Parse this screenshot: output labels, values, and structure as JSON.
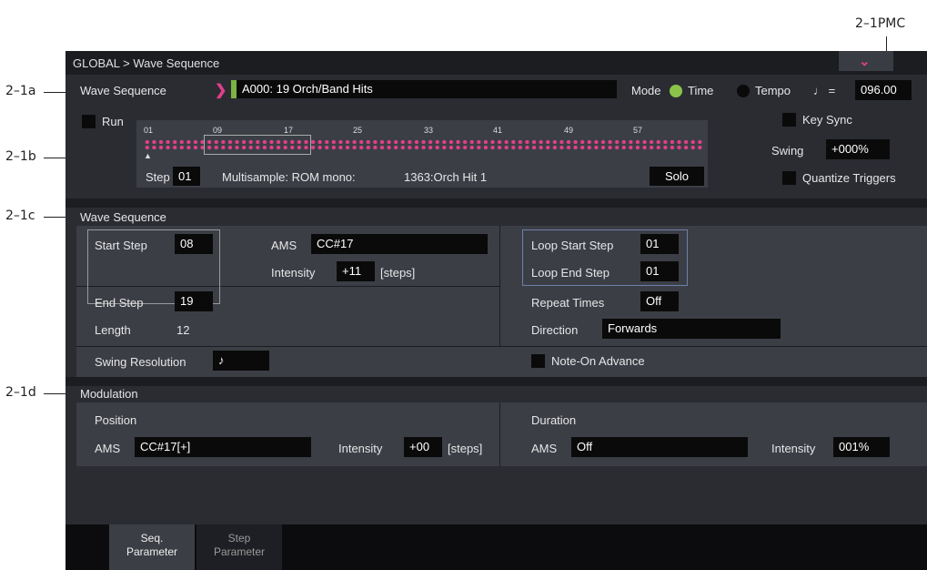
{
  "callouts": {
    "pmc": "2–1PMC",
    "a": "2–1a",
    "b": "2–1b",
    "c": "2–1c",
    "d": "2–1d"
  },
  "titlebar": {
    "path": "GLOBAL > Wave Sequence",
    "menu_icon": "chevron-down-icon"
  },
  "top": {
    "ws_label": "Wave Sequence",
    "ws_value": "A000: 19 Orch/Band Hits",
    "mode_label": "Mode",
    "mode_time": "Time",
    "mode_tempo": "Tempo",
    "tempo_symbol": "♩ =",
    "tempo_value": "096.00",
    "run_label": "Run",
    "key_sync_label": "Key Sync",
    "swing_label": "Swing",
    "swing_value": "+000%",
    "quantize_label": "Quantize Triggers"
  },
  "ruler": {
    "ticks": [
      "01",
      "09",
      "17",
      "25",
      "33",
      "41",
      "49",
      "57"
    ]
  },
  "step_bar": {
    "step_label": "Step",
    "step_value": "01",
    "multisample_label": "Multisample: ROM mono:",
    "multisample_value": "1363:Orch Hit 1",
    "solo_label": "Solo"
  },
  "ws_section": {
    "header": "Wave Sequence",
    "start_step_label": "Start Step",
    "start_step_value": "08",
    "end_step_label": "End Step",
    "end_step_value": "19",
    "length_label": "Length",
    "length_value": "12",
    "ams_label": "AMS",
    "ams_value": "CC#17",
    "intensity_label": "Intensity",
    "intensity_value": "+11",
    "intensity_unit": "[steps]",
    "loop_start_label": "Loop Start Step",
    "loop_start_value": "01",
    "loop_end_label": "Loop End Step",
    "loop_end_value": "01",
    "repeat_label": "Repeat Times",
    "repeat_value": "Off",
    "direction_label": "Direction",
    "direction_value": "Forwards",
    "swing_res_label": "Swing Resolution",
    "swing_res_value": "♪",
    "note_on_label": "Note-On Advance"
  },
  "mod_section": {
    "header": "Modulation",
    "position_label": "Position",
    "pos_ams_label": "AMS",
    "pos_ams_value": "CC#17[+]",
    "pos_int_label": "Intensity",
    "pos_int_value": "+00",
    "pos_int_unit": "[steps]",
    "duration_label": "Duration",
    "dur_ams_label": "AMS",
    "dur_ams_value": "Off",
    "dur_int_label": "Intensity",
    "dur_int_value": "001%"
  },
  "tabs": [
    {
      "line1": "Seq.",
      "line2": "Parameter"
    },
    {
      "line1": "Step",
      "line2": "Parameter"
    }
  ],
  "colors": {
    "accent": "#e0408a",
    "time_radio": "#8bc34a",
    "bar": "#7cb342"
  }
}
